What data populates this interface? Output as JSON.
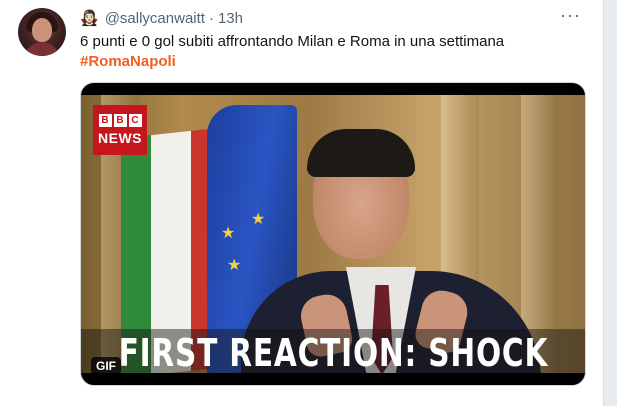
{
  "tweet": {
    "author_emoji": "🧛🏻‍♀️",
    "handle": "@sallycanwaitt",
    "separator": "·",
    "time": "13h",
    "more_label": "···",
    "text": "6 punti e 0 gol subiti affrontando Milan e Roma in una settimana",
    "hashtag": "#RomaNapoli"
  },
  "media": {
    "logo_letters": [
      "B",
      "B",
      "C"
    ],
    "logo_word": "NEWS",
    "caption": "FIRST REACTION: SHOCK",
    "badge": "GIF"
  },
  "colors": {
    "hashtag": "#f45d22",
    "secondary_text": "#536471",
    "bbc_red": "#c4161c"
  }
}
